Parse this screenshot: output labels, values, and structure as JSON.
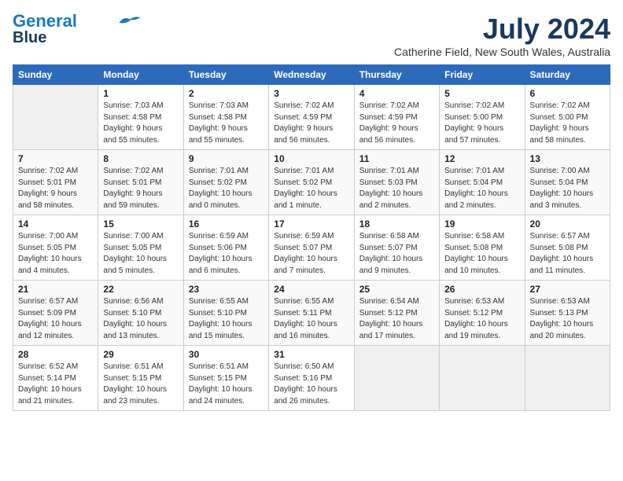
{
  "header": {
    "logo_line1": "General",
    "logo_line2": "Blue",
    "month": "July 2024",
    "location": "Catherine Field, New South Wales, Australia"
  },
  "columns": [
    "Sunday",
    "Monday",
    "Tuesday",
    "Wednesday",
    "Thursday",
    "Friday",
    "Saturday"
  ],
  "weeks": [
    [
      {
        "day": "",
        "info": ""
      },
      {
        "day": "1",
        "info": "Sunrise: 7:03 AM\nSunset: 4:58 PM\nDaylight: 9 hours\nand 55 minutes."
      },
      {
        "day": "2",
        "info": "Sunrise: 7:03 AM\nSunset: 4:58 PM\nDaylight: 9 hours\nand 55 minutes."
      },
      {
        "day": "3",
        "info": "Sunrise: 7:02 AM\nSunset: 4:59 PM\nDaylight: 9 hours\nand 56 minutes."
      },
      {
        "day": "4",
        "info": "Sunrise: 7:02 AM\nSunset: 4:59 PM\nDaylight: 9 hours\nand 56 minutes."
      },
      {
        "day": "5",
        "info": "Sunrise: 7:02 AM\nSunset: 5:00 PM\nDaylight: 9 hours\nand 57 minutes."
      },
      {
        "day": "6",
        "info": "Sunrise: 7:02 AM\nSunset: 5:00 PM\nDaylight: 9 hours\nand 58 minutes."
      }
    ],
    [
      {
        "day": "7",
        "info": "Sunrise: 7:02 AM\nSunset: 5:01 PM\nDaylight: 9 hours\nand 58 minutes."
      },
      {
        "day": "8",
        "info": "Sunrise: 7:02 AM\nSunset: 5:01 PM\nDaylight: 9 hours\nand 59 minutes."
      },
      {
        "day": "9",
        "info": "Sunrise: 7:01 AM\nSunset: 5:02 PM\nDaylight: 10 hours\nand 0 minutes."
      },
      {
        "day": "10",
        "info": "Sunrise: 7:01 AM\nSunset: 5:02 PM\nDaylight: 10 hours\nand 1 minute."
      },
      {
        "day": "11",
        "info": "Sunrise: 7:01 AM\nSunset: 5:03 PM\nDaylight: 10 hours\nand 2 minutes."
      },
      {
        "day": "12",
        "info": "Sunrise: 7:01 AM\nSunset: 5:04 PM\nDaylight: 10 hours\nand 2 minutes."
      },
      {
        "day": "13",
        "info": "Sunrise: 7:00 AM\nSunset: 5:04 PM\nDaylight: 10 hours\nand 3 minutes."
      }
    ],
    [
      {
        "day": "14",
        "info": "Sunrise: 7:00 AM\nSunset: 5:05 PM\nDaylight: 10 hours\nand 4 minutes."
      },
      {
        "day": "15",
        "info": "Sunrise: 7:00 AM\nSunset: 5:05 PM\nDaylight: 10 hours\nand 5 minutes."
      },
      {
        "day": "16",
        "info": "Sunrise: 6:59 AM\nSunset: 5:06 PM\nDaylight: 10 hours\nand 6 minutes."
      },
      {
        "day": "17",
        "info": "Sunrise: 6:59 AM\nSunset: 5:07 PM\nDaylight: 10 hours\nand 7 minutes."
      },
      {
        "day": "18",
        "info": "Sunrise: 6:58 AM\nSunset: 5:07 PM\nDaylight: 10 hours\nand 9 minutes."
      },
      {
        "day": "19",
        "info": "Sunrise: 6:58 AM\nSunset: 5:08 PM\nDaylight: 10 hours\nand 10 minutes."
      },
      {
        "day": "20",
        "info": "Sunrise: 6:57 AM\nSunset: 5:08 PM\nDaylight: 10 hours\nand 11 minutes."
      }
    ],
    [
      {
        "day": "21",
        "info": "Sunrise: 6:57 AM\nSunset: 5:09 PM\nDaylight: 10 hours\nand 12 minutes."
      },
      {
        "day": "22",
        "info": "Sunrise: 6:56 AM\nSunset: 5:10 PM\nDaylight: 10 hours\nand 13 minutes."
      },
      {
        "day": "23",
        "info": "Sunrise: 6:55 AM\nSunset: 5:10 PM\nDaylight: 10 hours\nand 15 minutes."
      },
      {
        "day": "24",
        "info": "Sunrise: 6:55 AM\nSunset: 5:11 PM\nDaylight: 10 hours\nand 16 minutes."
      },
      {
        "day": "25",
        "info": "Sunrise: 6:54 AM\nSunset: 5:12 PM\nDaylight: 10 hours\nand 17 minutes."
      },
      {
        "day": "26",
        "info": "Sunrise: 6:53 AM\nSunset: 5:12 PM\nDaylight: 10 hours\nand 19 minutes."
      },
      {
        "day": "27",
        "info": "Sunrise: 6:53 AM\nSunset: 5:13 PM\nDaylight: 10 hours\nand 20 minutes."
      }
    ],
    [
      {
        "day": "28",
        "info": "Sunrise: 6:52 AM\nSunset: 5:14 PM\nDaylight: 10 hours\nand 21 minutes."
      },
      {
        "day": "29",
        "info": "Sunrise: 6:51 AM\nSunset: 5:15 PM\nDaylight: 10 hours\nand 23 minutes."
      },
      {
        "day": "30",
        "info": "Sunrise: 6:51 AM\nSunset: 5:15 PM\nDaylight: 10 hours\nand 24 minutes."
      },
      {
        "day": "31",
        "info": "Sunrise: 6:50 AM\nSunset: 5:16 PM\nDaylight: 10 hours\nand 26 minutes."
      },
      {
        "day": "",
        "info": ""
      },
      {
        "day": "",
        "info": ""
      },
      {
        "day": "",
        "info": ""
      }
    ]
  ]
}
